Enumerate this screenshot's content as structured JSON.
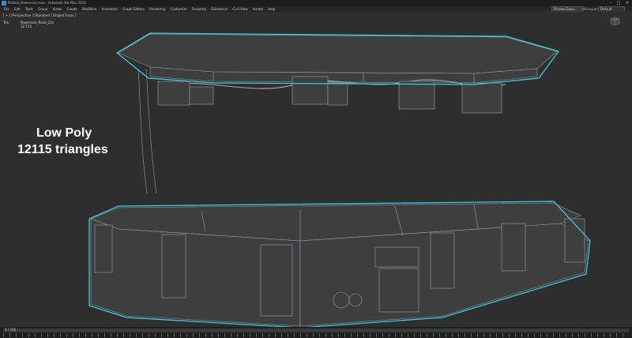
{
  "titlebar": {
    "title": "Pollolio_Powercore.max - Autodesk 3ds Max 2024",
    "minimize": "–",
    "maximize": "□",
    "close": "×"
  },
  "menubar": {
    "items": [
      "File",
      "Edit",
      "Tools",
      "Group",
      "Views",
      "Create",
      "Modifiers",
      "Animation",
      "Graph Editors",
      "Rendering",
      "Customize",
      "Scripting",
      "Substance",
      "Civil View",
      "Arnold",
      "Help"
    ],
    "sign_in": "Pranna Gaun...",
    "workspaces_label": "Workspaces:",
    "workspaces_value": "Default"
  },
  "viewport": {
    "label": "[ + ] [Perspective ] [Standard ] [Edged Faces ]",
    "stats_label": "Tris:",
    "stats_value": "12 115",
    "object_name": "Powercore_Rack_01a"
  },
  "overlay": {
    "line1": "Low Poly",
    "line2": "12115 triangles"
  },
  "timeline": {
    "counter": "0 / 100"
  },
  "colors": {
    "wire": "#9aa0a6",
    "selection": "#38d8e8",
    "mesh": "#3e3e3e",
    "background": "#2e2e2e"
  }
}
